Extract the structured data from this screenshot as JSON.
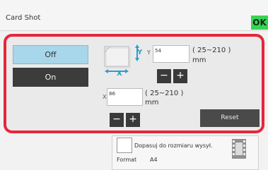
{
  "window": {
    "title": "Card Shot",
    "ok_label": "OK"
  },
  "mode": {
    "off_label": "Off",
    "on_label": "On",
    "selected": "Off"
  },
  "diagram": {
    "y_axis_label": "Y",
    "x_axis_label": "X"
  },
  "y_setting": {
    "prefix": "Y",
    "value": "54",
    "range": "( 25~210 )",
    "unit": "mm"
  },
  "x_setting": {
    "prefix": "X",
    "value": "86",
    "range": "( 25~210 )",
    "unit": "mm"
  },
  "steppers": {
    "minus": "−",
    "plus": "+"
  },
  "reset_label": "Reset",
  "fit_option": {
    "label": "Dopasuj do rozmiaru wysył.",
    "checked": false,
    "format_label": "Format",
    "format_value": "A4"
  },
  "colors": {
    "ok_green": "#39d353",
    "highlight_red": "#e5273b",
    "off_selected_blue": "#a8d6ea",
    "axis_blue": "#2a9fc8",
    "dark_button": "#3a3a3a"
  },
  "icons": {
    "card_diagram": "card-size-diagram-icon",
    "fit_icon": "film-frame-icon"
  }
}
